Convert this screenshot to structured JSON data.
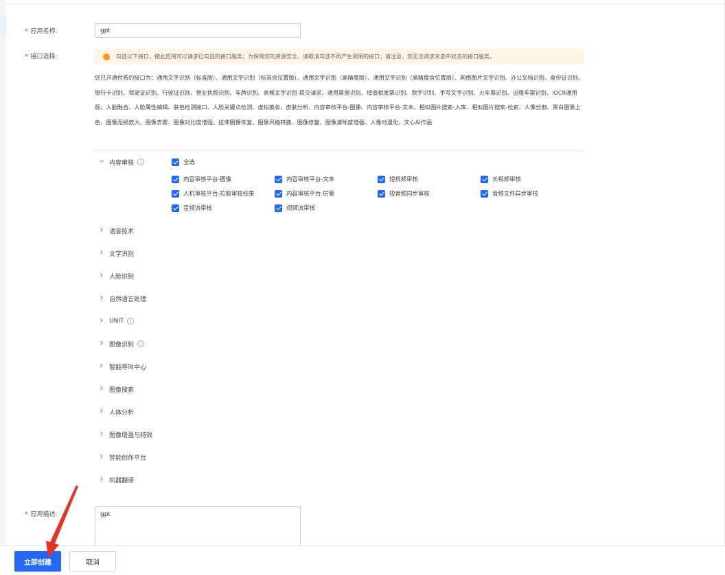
{
  "form": {
    "app_name": {
      "label": "应用名称:",
      "value": "gpt"
    },
    "interface": {
      "label": "接口选择:",
      "notice": "勾选以下接口，使此应用可以请求已勾选的接口服务；为保障您的资源安全，请取消勾选不再产生调用的接口；请注意，您无法请求未选中状态的接口服务。",
      "paid_text": "您已开通付费的接口为：通用文字识别（标准版）、通用文字识别（标准含位置版）、通用文字识别（高精度版）、通用文字识别（高精度含位置版）、网络图片文字识别、办公文档识别、身份证识别、银行卡识别、驾驶证识别、行驶证识别、营业执照识别、车牌识别、表格文字识别-提交请求、通用票据识别、增值税发票识别、数字识别、手写文字识别、火车票识别、出租车票识别、iOCR通用版、人脸融合、人脸属性编辑、肤色检测接口、人脸关键点检测、虚拟换妆、皮肤分析、内容审核平台-图像、内容审核平台-文本、相似图片搜索-入库、相似图片搜索-检索、人像分割、黑白图像上色、图像无损放大、图像去雾、图像对比度增强、拉伸图像恢复、图像风格转换、图像修复、图像清晰度增强、人像动漫化、文心AI作画",
      "expanded_category": {
        "label": "内容审核",
        "select_all": "全选",
        "items": [
          "内容审核平台-图像",
          "内容审核平台-文本",
          "短视频审核",
          "长视频审核",
          "人机审核平台-拉取审核结果",
          "内容审核平台-层章",
          "短音频同步审核",
          "音频文件异步审核",
          "音频流审核",
          "视频流审核"
        ]
      },
      "categories": [
        "语音技术",
        "文字识别",
        "人脸识别",
        "自然语言处理",
        "UNIT",
        "图像识别",
        "智能呼叫中心",
        "图像搜索",
        "人体分析",
        "图像增强与特效",
        "智能创作平台",
        "机器翻译"
      ]
    },
    "description": {
      "label": "应用描述:",
      "value": "gpt"
    }
  },
  "footer": {
    "create_label": "立即创建",
    "cancel_label": "取消"
  },
  "colors": {
    "primary": "#2468f2",
    "warning": "#ff9326",
    "required": "#f5222d",
    "annotation_arrow": "#e5332a"
  }
}
